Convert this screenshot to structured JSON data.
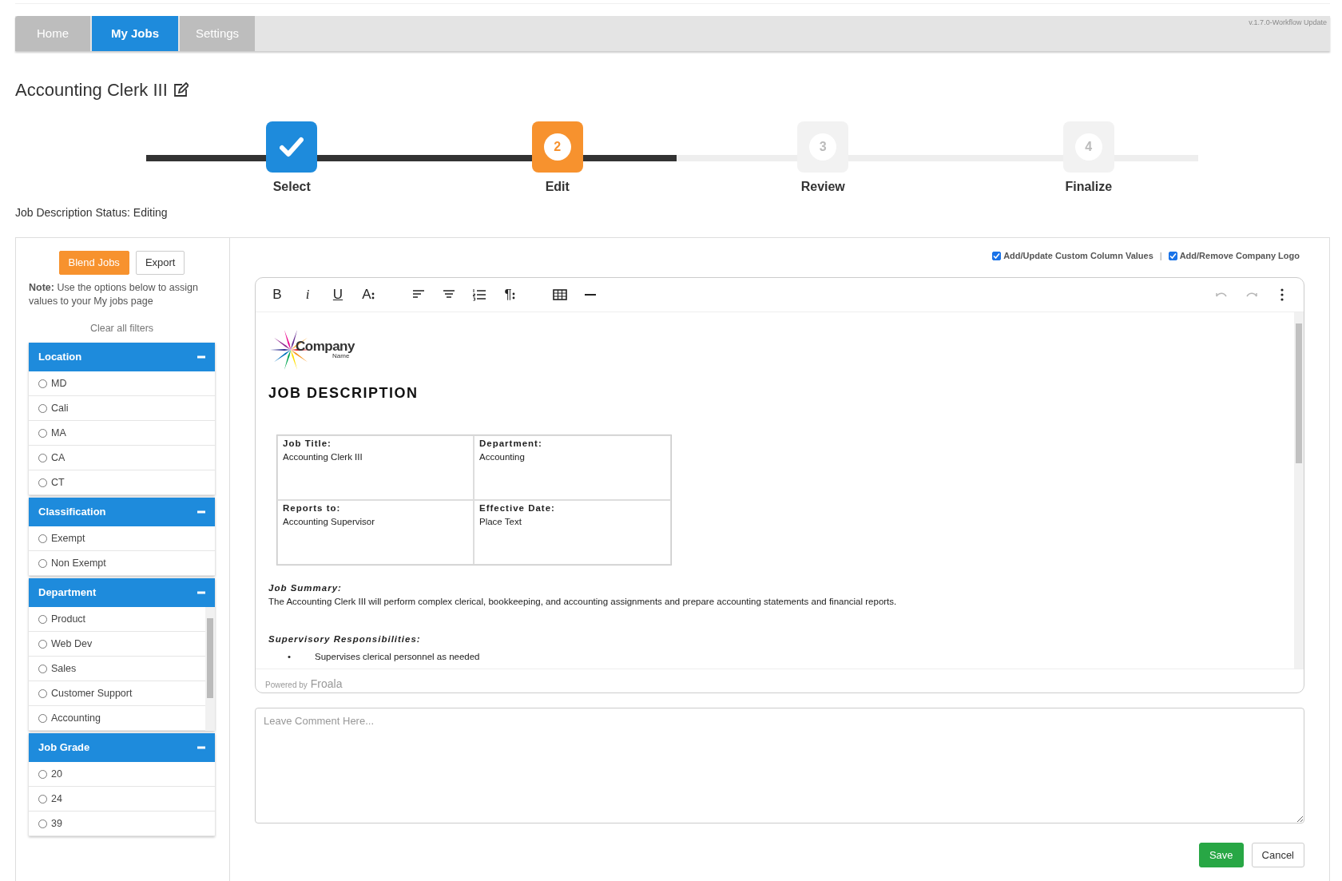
{
  "nav": {
    "tabs": [
      {
        "label": "Home",
        "selected": false
      },
      {
        "label": "My Jobs",
        "selected": true
      },
      {
        "label": "Settings",
        "selected": false
      }
    ],
    "version": "v.1.7.0-Workflow Update"
  },
  "page_title": "Accounting Clerk III",
  "stepper": [
    {
      "label": "Select",
      "completed": true,
      "selected": false
    },
    {
      "label": "Edit",
      "number": "2",
      "completed": false,
      "selected": true
    },
    {
      "label": "Review",
      "number": "3",
      "completed": false,
      "selected": false
    },
    {
      "label": "Finalize",
      "number": "4",
      "completed": false,
      "selected": false
    }
  ],
  "status": "Job Description Status: Editing",
  "sidebar": {
    "buttons": [
      {
        "label": "Blend Jobs",
        "kind": "primary"
      },
      {
        "label": "Export",
        "kind": "outline"
      }
    ],
    "note": "**Note:** Use the options below to assign values to your My jobs page",
    "clear_filters": "Clear all filters",
    "filters": [
      {
        "title": "Location",
        "expanded": true,
        "scrollable": false,
        "options": [
          {
            "label": "MD",
            "selected": false
          },
          {
            "label": "Cali",
            "selected": false
          },
          {
            "label": "MA",
            "selected": false
          },
          {
            "label": "CA",
            "selected": false
          },
          {
            "label": "CT",
            "selected": false
          }
        ]
      },
      {
        "title": "Classification",
        "expanded": true,
        "scrollable": false,
        "options": [
          {
            "label": "Exempt",
            "selected": false
          },
          {
            "label": "Non Exempt",
            "selected": false
          }
        ]
      },
      {
        "title": "Department",
        "expanded": true,
        "scrollable": true,
        "options": [
          {
            "label": "Product",
            "selected": false
          },
          {
            "label": "Web Dev",
            "selected": false
          },
          {
            "label": "Sales",
            "selected": false
          },
          {
            "label": "Customer Support",
            "selected": false
          },
          {
            "label": "Accounting",
            "selected": false
          }
        ]
      },
      {
        "title": "Job Grade",
        "expanded": true,
        "scrollable": false,
        "options": [
          {
            "label": "20",
            "selected": false
          },
          {
            "label": "24",
            "selected": false
          },
          {
            "label": "39",
            "selected": false
          }
        ]
      }
    ]
  },
  "editor": {
    "options": [
      {
        "label": "Add/Update Custom Column Values",
        "checked": true
      },
      {
        "label": "Add/Remove Company Logo",
        "checked": true
      }
    ],
    "options_separator": "|",
    "toolbar": [
      [
        {
          "kind": "bold",
          "glyph": "B"
        },
        {
          "kind": "italic",
          "glyph": "i"
        },
        {
          "kind": "underline",
          "glyph": "U"
        },
        {
          "kind": "font-size",
          "glyph": "A"
        }
      ],
      [
        {
          "kind": "align-left"
        },
        {
          "kind": "align-center"
        },
        {
          "kind": "ordered-list"
        },
        {
          "kind": "paragraph",
          "glyph": "¶"
        }
      ],
      [
        {
          "kind": "table"
        },
        {
          "kind": "horizontal-line"
        }
      ]
    ],
    "history": [
      {
        "kind": "undo",
        "disabled": true
      },
      {
        "kind": "redo",
        "disabled": true
      }
    ],
    "document": {
      "logo": {
        "name": "Company",
        "tagline": "Name"
      },
      "heading": "JOB DESCRIPTION",
      "fields": [
        {
          "label": "Job Title:",
          "value": "Accounting Clerk III"
        },
        {
          "label": "Department:",
          "value": "Accounting"
        },
        {
          "label": "Reports to:",
          "value": "Accounting Supervisor"
        },
        {
          "label": "Effective Date:",
          "value": "Place Text"
        }
      ],
      "sections": [
        {
          "title": "Job Summary:",
          "text": "The Accounting Clerk III will perform complex clerical, bookkeeping, and accounting assignments and prepare accounting statements and financial reports."
        },
        {
          "title": "Supervisory Responsibilities:",
          "bullets": [
            {
              "marker": "•",
              "text": "Supervises clerical personnel as needed"
            }
          ]
        }
      ]
    },
    "powered_by": "Powered by",
    "brand": "Froala"
  },
  "comment": {
    "placeholder": "Leave Comment Here..."
  },
  "actions": [
    {
      "label": "Save",
      "kind": "save"
    },
    {
      "label": "Cancel",
      "kind": "cancel"
    }
  ]
}
